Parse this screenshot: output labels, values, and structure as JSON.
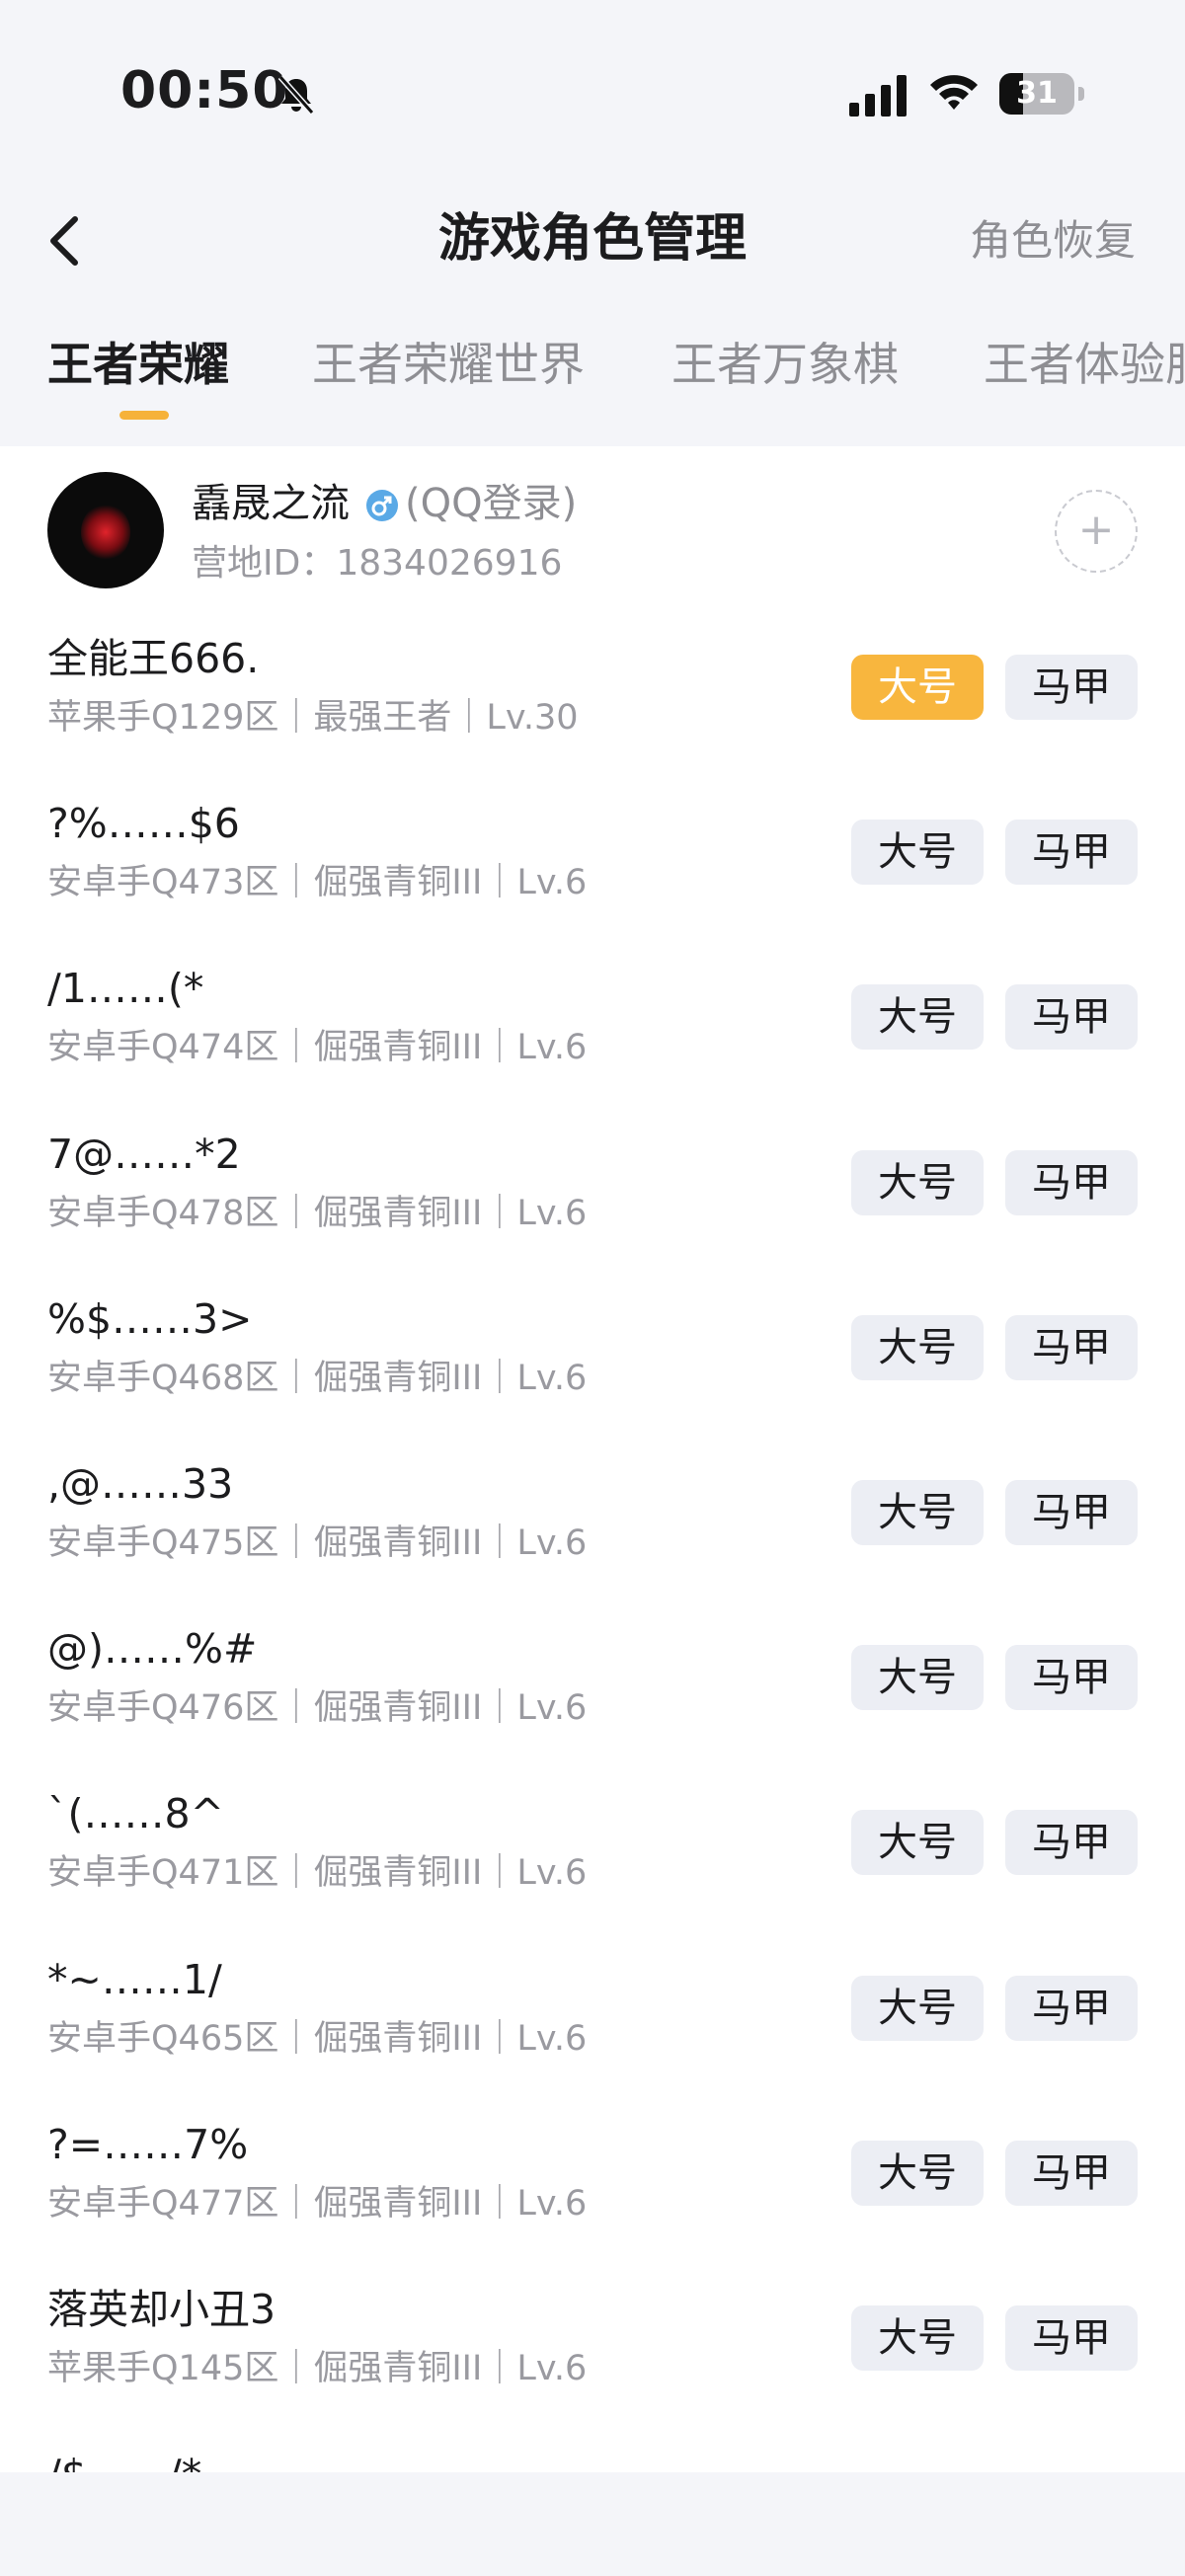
{
  "status_bar": {
    "time": "00:50",
    "battery": "31",
    "battery_level": 0.31
  },
  "nav": {
    "title": "游戏角色管理",
    "right_action": "角色恢复"
  },
  "tabs": [
    {
      "label": "王者荣耀",
      "active": true
    },
    {
      "label": "王者荣耀世界",
      "active": false
    },
    {
      "label": "王者万象棋",
      "active": false
    },
    {
      "label": "王者体验服",
      "active": false
    }
  ],
  "account": {
    "name": "舙晟之流",
    "login": "(QQ登录)",
    "camp_id": "营地ID：1834026916",
    "add_icon": "+"
  },
  "roles": [
    {
      "name": "全能王666.",
      "meta": "苹果手Q129区｜最强王者｜Lv.30",
      "main_label": "大号",
      "alt_label": "马甲",
      "is_main": true
    },
    {
      "name": "?%……$6",
      "meta": "安卓手Q473区｜倔强青铜III｜Lv.6",
      "main_label": "大号",
      "alt_label": "马甲",
      "is_main": false
    },
    {
      "name": "/1……(*",
      "meta": "安卓手Q474区｜倔强青铜III｜Lv.6",
      "main_label": "大号",
      "alt_label": "马甲",
      "is_main": false
    },
    {
      "name": "7@……*2",
      "meta": "安卓手Q478区｜倔强青铜III｜Lv.6",
      "main_label": "大号",
      "alt_label": "马甲",
      "is_main": false
    },
    {
      "name": "%$……3>",
      "meta": "安卓手Q468区｜倔强青铜III｜Lv.6",
      "main_label": "大号",
      "alt_label": "马甲",
      "is_main": false
    },
    {
      "name": ",@……33",
      "meta": "安卓手Q475区｜倔强青铜III｜Lv.6",
      "main_label": "大号",
      "alt_label": "马甲",
      "is_main": false
    },
    {
      "name": "@)……%#",
      "meta": "安卓手Q476区｜倔强青铜III｜Lv.6",
      "main_label": "大号",
      "alt_label": "马甲",
      "is_main": false
    },
    {
      "name": "`(……8^",
      "meta": "安卓手Q471区｜倔强青铜III｜Lv.6",
      "main_label": "大号",
      "alt_label": "马甲",
      "is_main": false
    },
    {
      "name": "*~……1/",
      "meta": "安卓手Q465区｜倔强青铜III｜Lv.6",
      "main_label": "大号",
      "alt_label": "马甲",
      "is_main": false
    },
    {
      "name": "?=……7%",
      "meta": "安卓手Q477区｜倔强青铜III｜Lv.6",
      "main_label": "大号",
      "alt_label": "马甲",
      "is_main": false
    },
    {
      "name": "落英却小丑3",
      "meta": "苹果手Q145区｜倔强青铜III｜Lv.6",
      "main_label": "大号",
      "alt_label": "马甲",
      "is_main": false
    },
    {
      "name": "/$……/*",
      "meta": "",
      "main_label": "",
      "alt_label": "",
      "is_main": false
    }
  ],
  "colors": {
    "accent": "#f8b63e",
    "background": "#f4f5f9",
    "secondary_text": "#9a9aa0"
  }
}
